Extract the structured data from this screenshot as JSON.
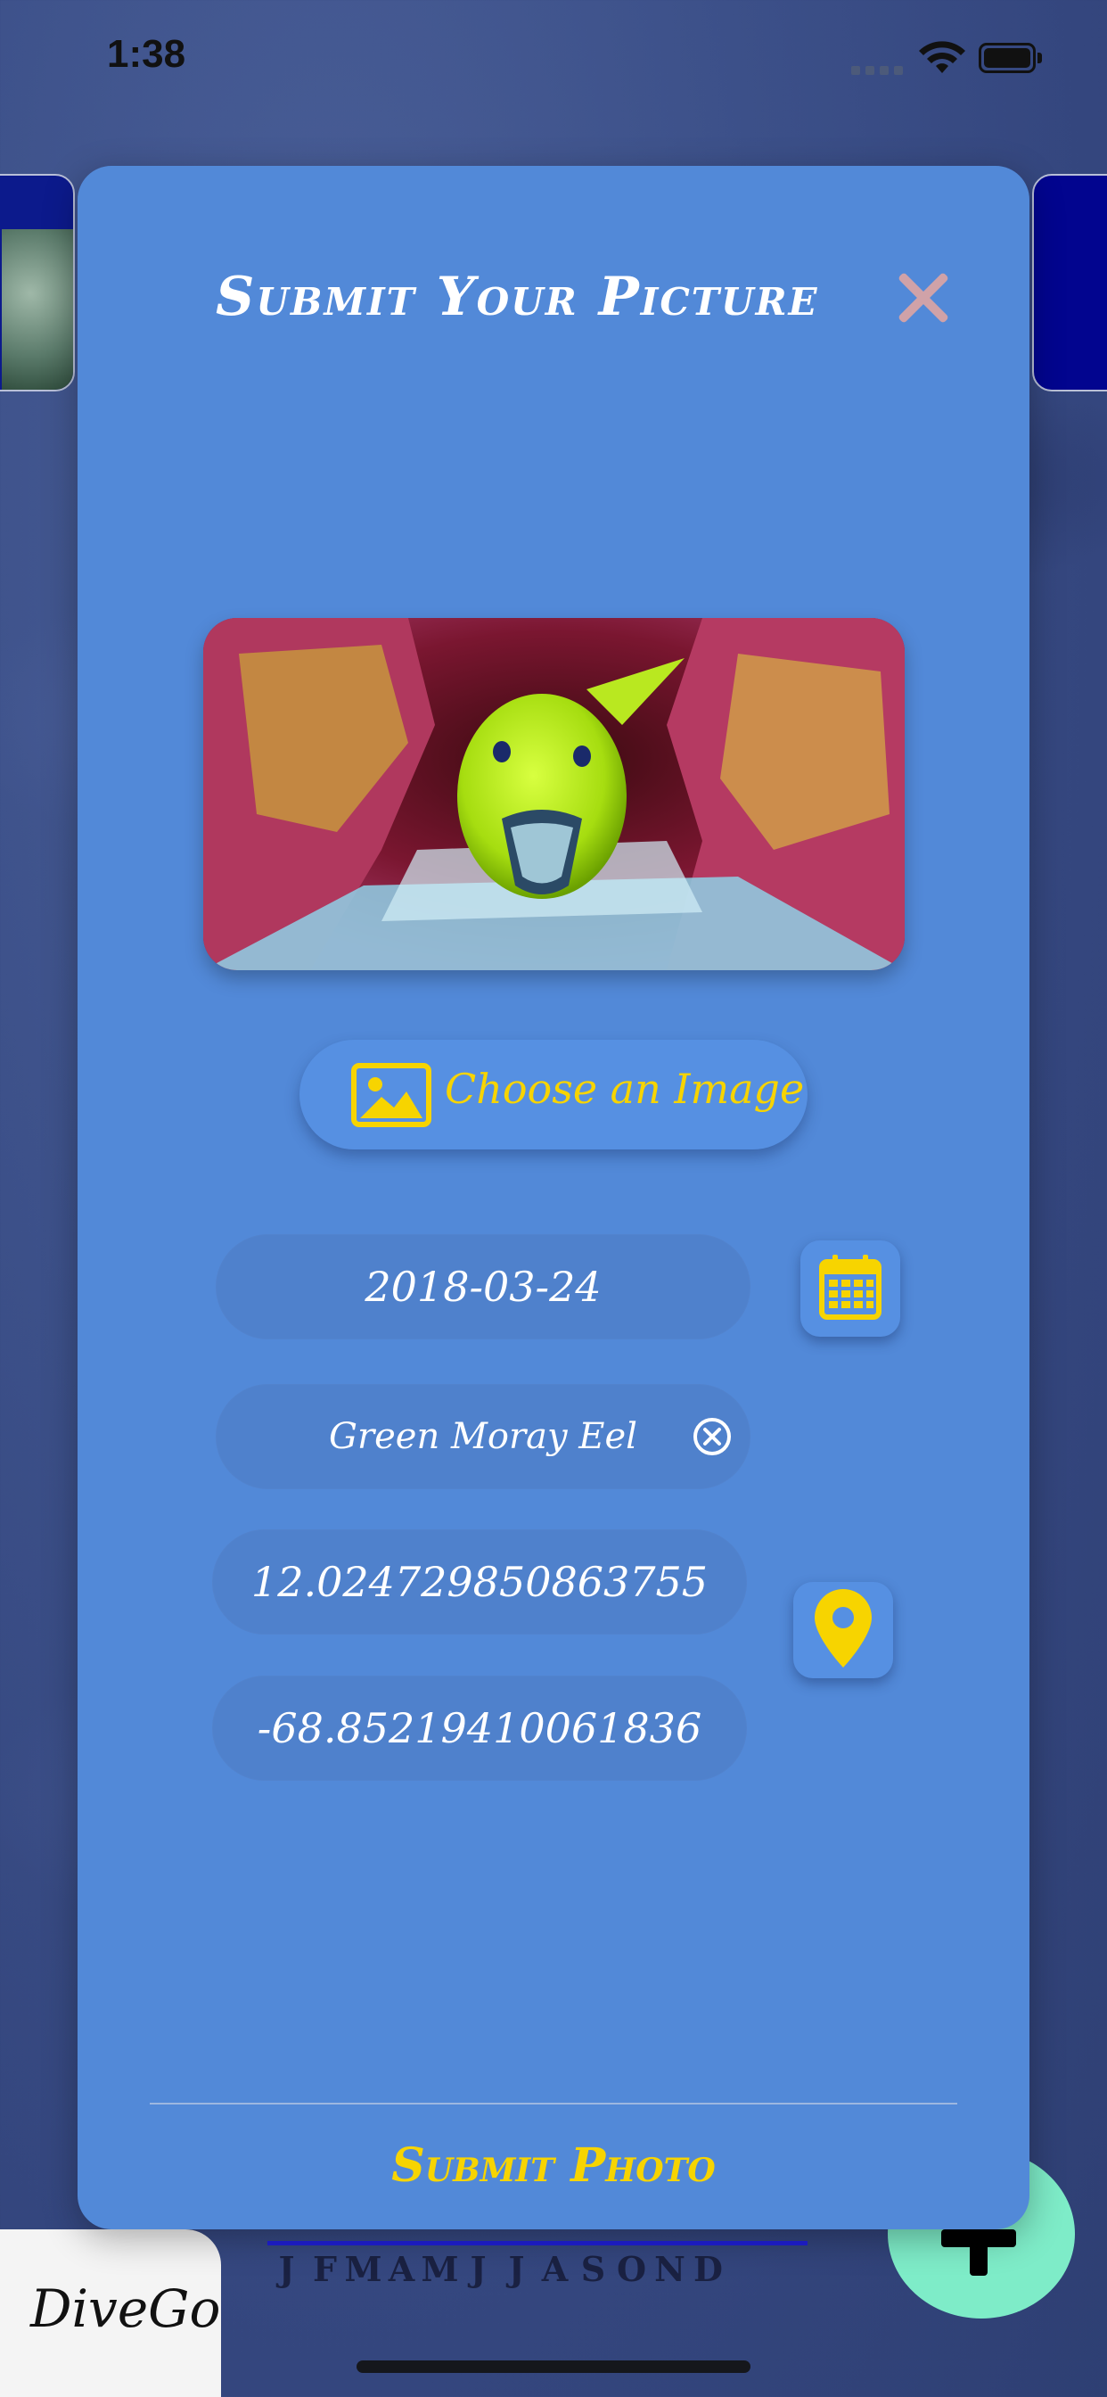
{
  "status_bar": {
    "time": "1:38"
  },
  "modal": {
    "title": "Submit Your Picture",
    "choose_image_label": "Choose an Image",
    "date_value": "2018-03-24",
    "species_value": "Green Moray Eel",
    "latitude_value": "12.024729850863755",
    "longitude_value": "-68.85219410061836",
    "submit_label": "Submit Photo"
  },
  "bottom_bar": {
    "brand": "DiveGo",
    "months": [
      "J",
      "F",
      "M",
      "A",
      "M",
      "J",
      "J",
      "A",
      "S",
      "O",
      "N",
      "D"
    ]
  },
  "colors": {
    "modal_bg": "#5289d8",
    "accent_yellow": "#f7d400",
    "fab_green": "#7eecc8"
  },
  "icons": {
    "close": "close-icon",
    "image": "image-icon",
    "calendar": "calendar-icon",
    "location": "location-pin-icon",
    "clear": "clear-circle-x-icon",
    "add": "plus-icon"
  }
}
